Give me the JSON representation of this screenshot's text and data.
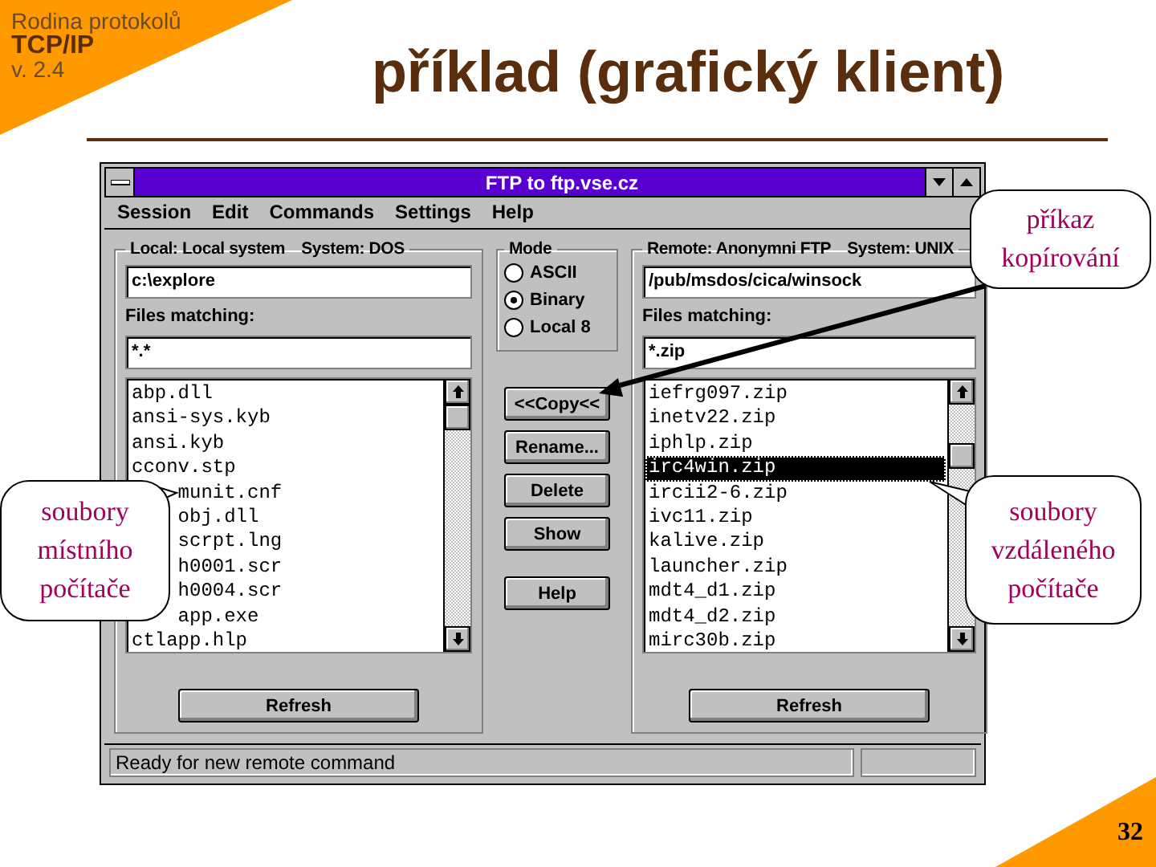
{
  "slide": {
    "series": "Rodina protokolů",
    "protocol": "TCP/IP",
    "version": "v. 2.4",
    "title": "příklad (grafický klient)",
    "page_number": "32"
  },
  "window": {
    "title": "FTP to ftp.vse.cz",
    "menu": [
      "Session",
      "Edit",
      "Commands",
      "Settings",
      "Help"
    ],
    "local": {
      "label": "Local: Local system",
      "system": "System: DOS",
      "path": "c:\\explore",
      "files_label": "Files matching:",
      "filter": "*.*",
      "refresh": "Refresh",
      "files": [
        {
          "name": "abp.dll",
          "selected": false,
          "covered": false
        },
        {
          "name": "ansi-sys.kyb",
          "selected": false,
          "covered": false
        },
        {
          "name": "ansi.kyb",
          "selected": false,
          "covered": false
        },
        {
          "name": "cconv.stp",
          "selected": false,
          "covered": false
        },
        {
          "name": "munit.cnf",
          "selected": false,
          "covered": true
        },
        {
          "name": "obj.dll",
          "selected": false,
          "covered": true
        },
        {
          "name": "scrpt.lng",
          "selected": false,
          "covered": true
        },
        {
          "name": "h0001.scr",
          "selected": false,
          "covered": true
        },
        {
          "name": "h0004.scr",
          "selected": false,
          "covered": true
        },
        {
          "name": "app.exe",
          "selected": false,
          "covered": true
        },
        {
          "name": "ctlapp.hlp",
          "selected": false,
          "covered": false
        }
      ]
    },
    "mode": {
      "label": "Mode",
      "options": [
        {
          "label": "ASCII",
          "selected": false
        },
        {
          "label": "Binary",
          "selected": true
        },
        {
          "label": "Local 8",
          "selected": false
        }
      ]
    },
    "actions": [
      "<<Copy<<",
      "Rename...",
      "Delete",
      "Show",
      "Help"
    ],
    "remote": {
      "label": "Remote: Anonymni FTP",
      "system": "System: UNIX",
      "path": "/pub/msdos/cica/winsock",
      "files_label": "Files matching:",
      "filter": "*.zip",
      "refresh": "Refresh",
      "files": [
        {
          "name": "iefrg097.zip",
          "selected": false,
          "covered": false
        },
        {
          "name": "inetv22.zip",
          "selected": false,
          "covered": false
        },
        {
          "name": "iphlp.zip",
          "selected": false,
          "covered": false
        },
        {
          "name": "irc4win.zip",
          "selected": true,
          "covered": false
        },
        {
          "name": "ircii2-6.zip",
          "selected": false,
          "covered": false
        },
        {
          "name": "ivc11.zip",
          "selected": false,
          "covered": false
        },
        {
          "name": "kalive.zip",
          "selected": false,
          "covered": false
        },
        {
          "name": "launcher.zip",
          "selected": false,
          "covered": false
        },
        {
          "name": "mdt4_d1.zip",
          "selected": false,
          "covered": false
        },
        {
          "name": "mdt4_d2.zip",
          "selected": false,
          "covered": false
        },
        {
          "name": "mirc30b.zip",
          "selected": false,
          "covered": false
        }
      ]
    },
    "status": "Ready for new remote command"
  },
  "callouts": [
    {
      "kind": "pointer",
      "lines": [
        "příkaz",
        "kopírování"
      ]
    },
    {
      "kind": "local",
      "lines": [
        "soubory",
        "místního",
        "počítače"
      ]
    },
    {
      "kind": "remote",
      "lines": [
        "soubory",
        "vzdáleného",
        "počítače"
      ]
    }
  ]
}
